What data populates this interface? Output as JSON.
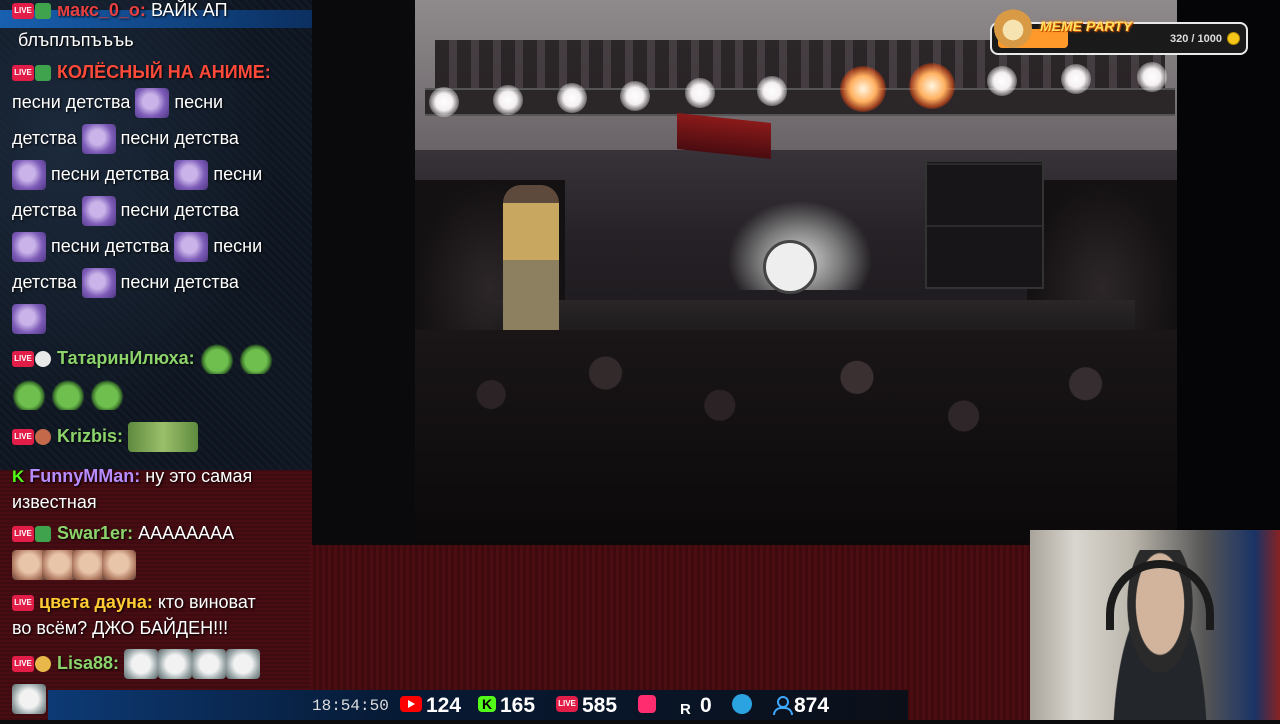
{
  "chat": {
    "messages": [
      {
        "nick": "макс_0_о:",
        "text": "ВАЙК АП",
        "nick_color": "#e84040"
      },
      {
        "nick": "",
        "text": "блъплъпъъъь",
        "nick_color": "#ffffff"
      },
      {
        "nick": "КОЛЁСНЫЙ НА АНИМЕ:",
        "text": "",
        "nick_color": "#ff4a3a"
      },
      {
        "nick": "ТатаринИлюха:",
        "text": "",
        "nick_color": "#8bd36a"
      },
      {
        "nick": "Krizbis:",
        "text": "",
        "nick_color": "#8bd36a"
      },
      {
        "nick": "FunnyMMan:",
        "text": "ну это самая",
        "text2": "известная",
        "nick_color": "#b68cff"
      },
      {
        "nick": "Swar1er:",
        "text": "АААААААА",
        "nick_color": "#8bd36a"
      },
      {
        "nick": "цвета дауна:",
        "text": "кто виноват",
        "text2": "во всём? ДЖО БАЙДЕН!!!",
        "nick_color": "#ffcc33"
      },
      {
        "nick": "Lisa88:",
        "text": "",
        "nick_color": "#8bd36a"
      }
    ],
    "repeat_text": "песни детства",
    "lines": [
      "песни детства",
      "песни",
      "детства",
      "песни детства",
      "песни детства",
      "песни",
      "детства",
      "песни детства",
      "песни детства",
      "песни",
      "детства",
      "песни детства"
    ]
  },
  "widget": {
    "title": "MEME PARTY",
    "progress": "320 / 1000",
    "progress_fraction": 0.32
  },
  "status": {
    "time": "18:54:50",
    "youtube": "124",
    "kick": "165",
    "vklive": "585",
    "vkvideo": "",
    "rutube": "0",
    "telegram": "",
    "total": "874",
    "live_label": "LIVE"
  },
  "colors": {
    "live_badge": "#e11d48",
    "kick_green": "#53fc18",
    "youtube_red": "#ff0000",
    "accent_blue": "#3fa9ff"
  }
}
